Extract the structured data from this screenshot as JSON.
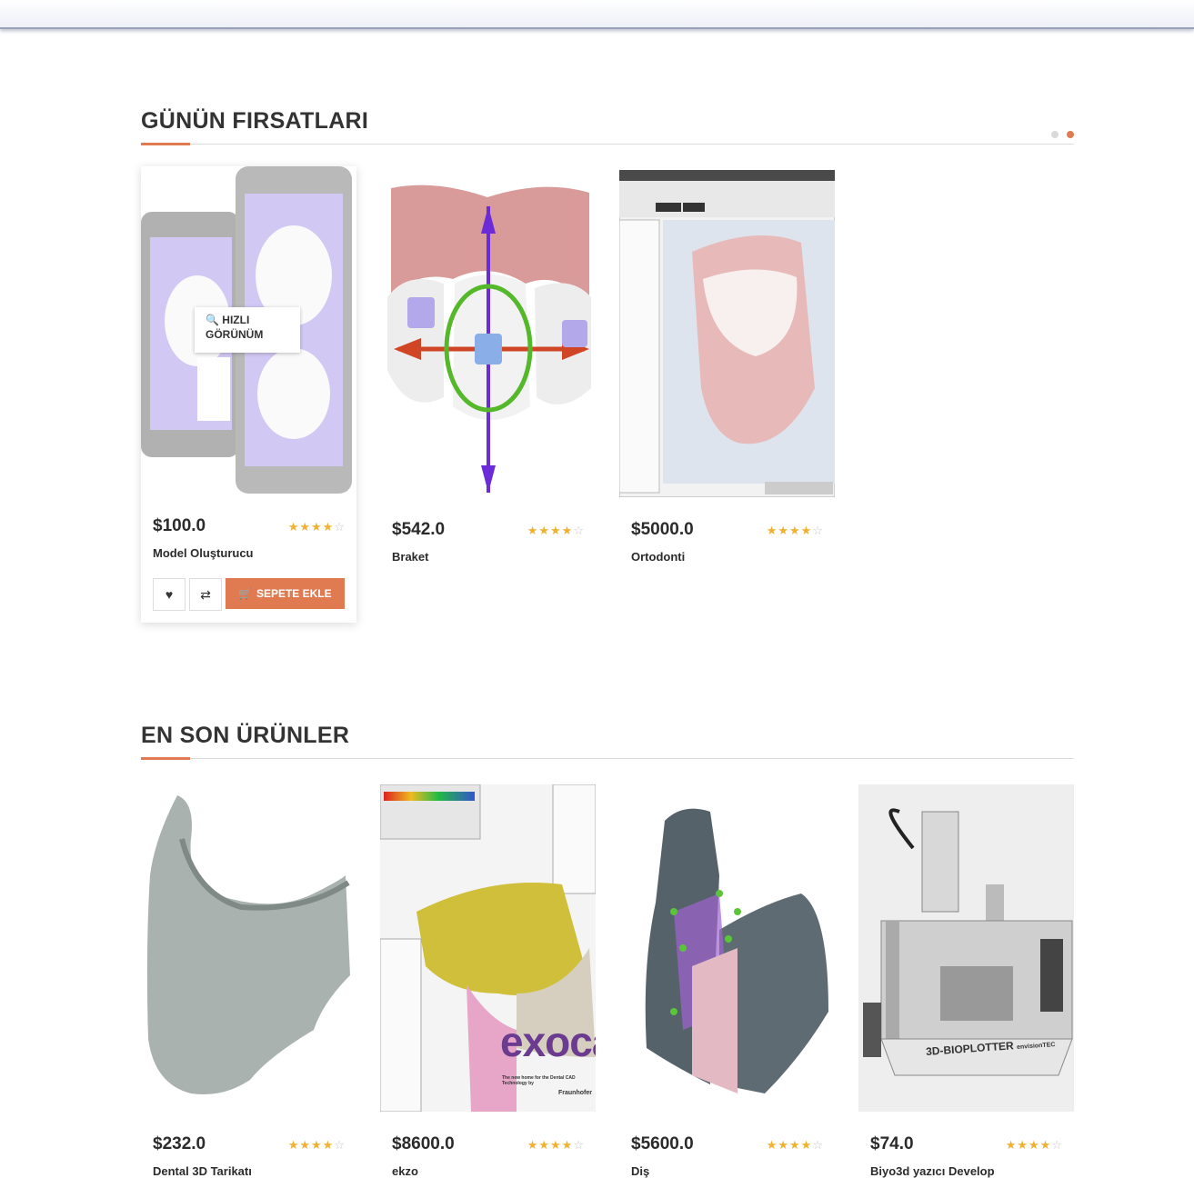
{
  "deals": {
    "title": "GÜNÜN FIRSATLARI",
    "quick_view_label": "HIZLI GÖRÜNÜM",
    "add_to_cart_label": "SEPETE EKLE",
    "products": [
      {
        "price": "$100.0",
        "name": "Model Oluşturucu",
        "rating": 4,
        "max_rating": 5
      },
      {
        "price": "$542.0",
        "name": "Braket",
        "rating": 4,
        "max_rating": 5
      },
      {
        "price": "$5000.0",
        "name": "Ortodonti",
        "rating": 4,
        "max_rating": 5
      }
    ]
  },
  "latest": {
    "title": "EN SON ÜRÜNLER",
    "products": [
      {
        "price": "$232.0",
        "name": "Dental 3D Tarikatı",
        "rating": 4,
        "max_rating": 5
      },
      {
        "price": "$8600.0",
        "name": "ekzo",
        "rating": 4,
        "max_rating": 5,
        "image_text": "exocad",
        "image_subtext": "The new home for the Dental CAD Technology by",
        "image_brand": "Fraunhofer"
      },
      {
        "price": "$5600.0",
        "name": "Diş",
        "rating": 4,
        "max_rating": 5
      },
      {
        "price": "$74.0",
        "name": "Biyo3d yazıcı Develop",
        "rating": 4,
        "max_rating": 5,
        "image_text": "3D-BIOPLOTTER",
        "image_brand": "envisionTEC"
      }
    ]
  },
  "colors": {
    "accent": "#e07a50",
    "star": "#f0b030"
  },
  "icons": {
    "heart": "heart-icon",
    "compare": "compare-icon",
    "cart": "cart-icon",
    "search": "magnifier-icon"
  }
}
